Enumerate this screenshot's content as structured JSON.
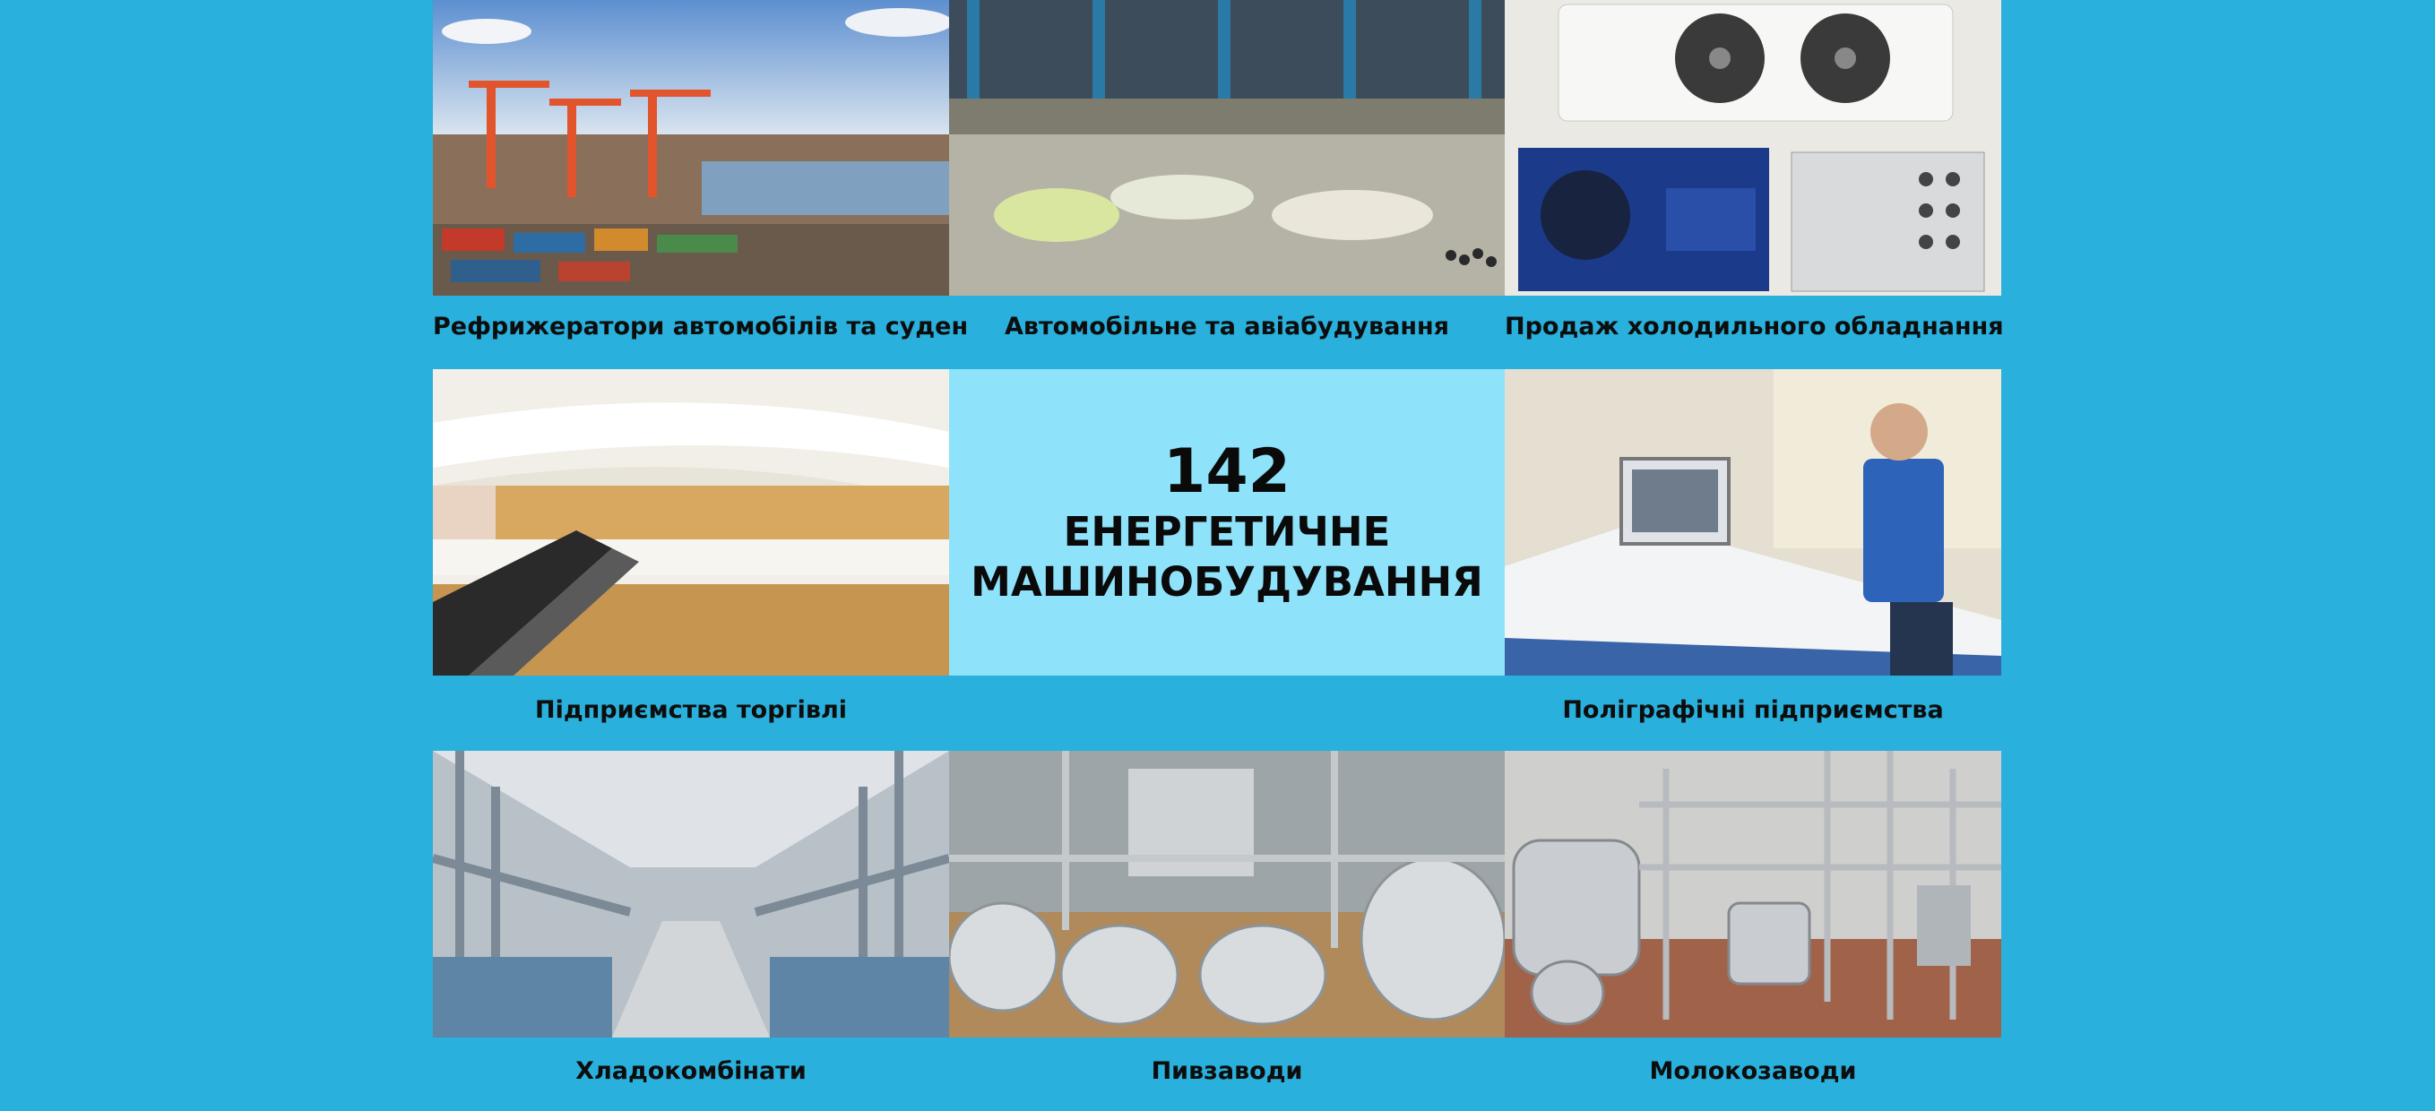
{
  "colors": {
    "background": "#29b0dc",
    "center_panel": "#8ee3fa",
    "text": "#0d0d0d"
  },
  "center": {
    "number": "142",
    "line1": "ЕНЕРГЕТИЧНЕ",
    "line2": "МАШИНОБУДУВАННЯ"
  },
  "tiles": [
    {
      "image": "port-cranes-image",
      "caption": "Рефрижератори автомобілів та суден"
    },
    {
      "image": "aircraft-factory-image",
      "caption": "Автомобільне та авіабудування"
    },
    {
      "image": "refrigeration-equipment-image",
      "caption": "Продаж холодильного обладнання"
    },
    {
      "image": "shopping-mall-image",
      "caption": "Підприємства торгівлі"
    },
    {
      "image": "printing-press-image",
      "caption": "Поліграфічні підприємства"
    },
    {
      "image": "cold-storage-plant-image",
      "caption": "Хладокомбінати"
    },
    {
      "image": "brewery-image",
      "caption": "Пивзаводи"
    },
    {
      "image": "dairy-plant-image",
      "caption": "Молокозаводи"
    }
  ]
}
